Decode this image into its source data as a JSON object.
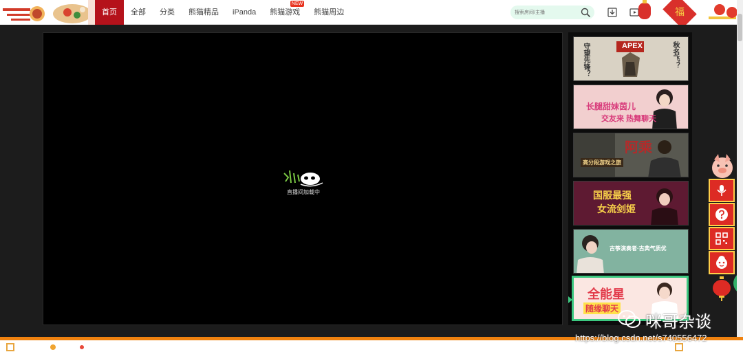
{
  "nav": {
    "items": [
      {
        "label": "首页",
        "active": true
      },
      {
        "label": "全部"
      },
      {
        "label": "分类"
      },
      {
        "label": "熊猫精品"
      },
      {
        "label": "iPanda"
      },
      {
        "label": "熊猫游戏",
        "badge": "NEW"
      },
      {
        "label": "熊猫周边"
      }
    ]
  },
  "search": {
    "placeholder": "搜索房间/主播"
  },
  "player": {
    "loading_text": "直播间加载中"
  },
  "sidebar": {
    "thumbnails": [
      {
        "texts": [
          "APEX",
          "守望先锋？",
          "秋名飞？"
        ],
        "bg": "#d6cfc2",
        "icon": "apex-game-thumbnail"
      },
      {
        "texts": [
          "长腿甜妹茵儿",
          "交友来 热舞聊天"
        ],
        "bg": "#f1c9c9",
        "icon": "dance-streamer-thumbnail"
      },
      {
        "texts": [
          "阿乘",
          "高分段游戏之旅"
        ],
        "bg": "#5a5a52",
        "icon": "gaming-streamer-thumbnail"
      },
      {
        "texts": [
          "国服最强",
          "女流剑姬"
        ],
        "bg": "#6d1f38",
        "icon": "lol-streamer-thumbnail"
      },
      {
        "texts": [
          "古筝演奏者·古典气质优"
        ],
        "bg": "#86b7a4",
        "icon": "guzheng-streamer-thumbnail"
      },
      {
        "texts": [
          "全能星",
          "随缘聊天"
        ],
        "bg": "#fbe8e4",
        "icon": "variety-streamer-thumbnail",
        "active": true
      }
    ]
  },
  "float_bar": {
    "buttons": [
      "microphone-icon",
      "help-icon",
      "qr-code-icon",
      "mascot-icon"
    ]
  },
  "watermark": {
    "brand": "咪哥杂谈",
    "url": "https://blog.csdn.net/s740556472"
  },
  "colors": {
    "nav_active": "#b5121b",
    "search_bg": "#e4f9ee",
    "accent_green": "#3cc880",
    "float_red": "#dd2b24",
    "bottom_orange": "#f0820f"
  }
}
